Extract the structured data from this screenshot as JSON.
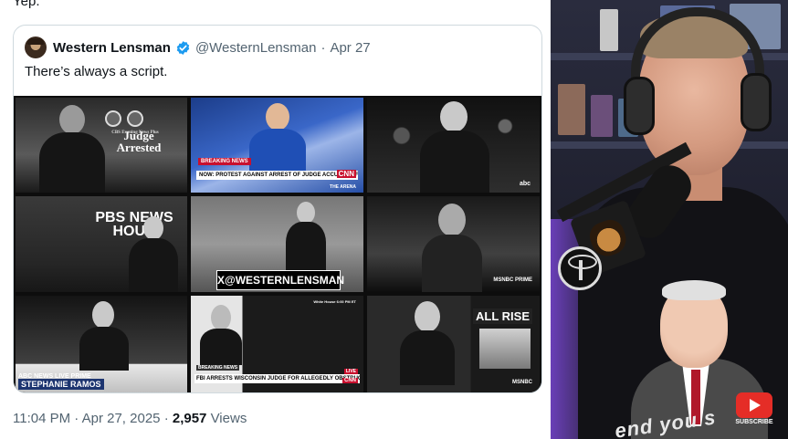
{
  "reply": {
    "text": "Yep."
  },
  "quote": {
    "author_name": "Western Lensman",
    "handle": "@WesternLensman",
    "separator": "·",
    "date": "Apr 27",
    "text": "There’s always a script."
  },
  "media_labels": {
    "c1_small": "CBS Evening News Plus",
    "c1_headline": "Judge Arrested",
    "c2_breaking": "BREAKING NEWS",
    "c2_lower_third": "NOW: PROTEST AGAINST ARREST OF JUDGE ACCUSED OF OBSTRUCTING ICE",
    "c2_network": "CNN",
    "c2_show": "THE ARENA",
    "c3_network": "abc",
    "c4_logo": "PBS NEWS HOUR",
    "c5_watermark": "X@WESTERNLENSMAN",
    "c6_network": "MSNBC PRIME",
    "c7_show": "ABC NEWS LIVE PRIME",
    "c7_anchor": "STEPHANIE RAMOS",
    "c8_location": "White House 6:00 PM ET",
    "c8_breaking": "BREAKING NEWS",
    "c8_live": "LIVE",
    "c8_lower_third": "FBI ARRESTS WISCONSIN JUDGE FOR ALLEGEDLY OBSTRUCTING ICE",
    "c8_network": "CNN",
    "c9_headline": "ALL RISE",
    "c9_network": "MSNBC"
  },
  "meta": {
    "time": "11:04 PM",
    "separator": "·",
    "date": "Apr 27, 2025",
    "views_count": "2,957",
    "views_label": "Views"
  },
  "webcam": {
    "shirt_text": "end you s",
    "subscribe_label": "SUBSCRIBE"
  },
  "colors": {
    "verified": "#1d9bf0",
    "meta_gray": "#536471",
    "subscribe_red": "#e52d27"
  }
}
